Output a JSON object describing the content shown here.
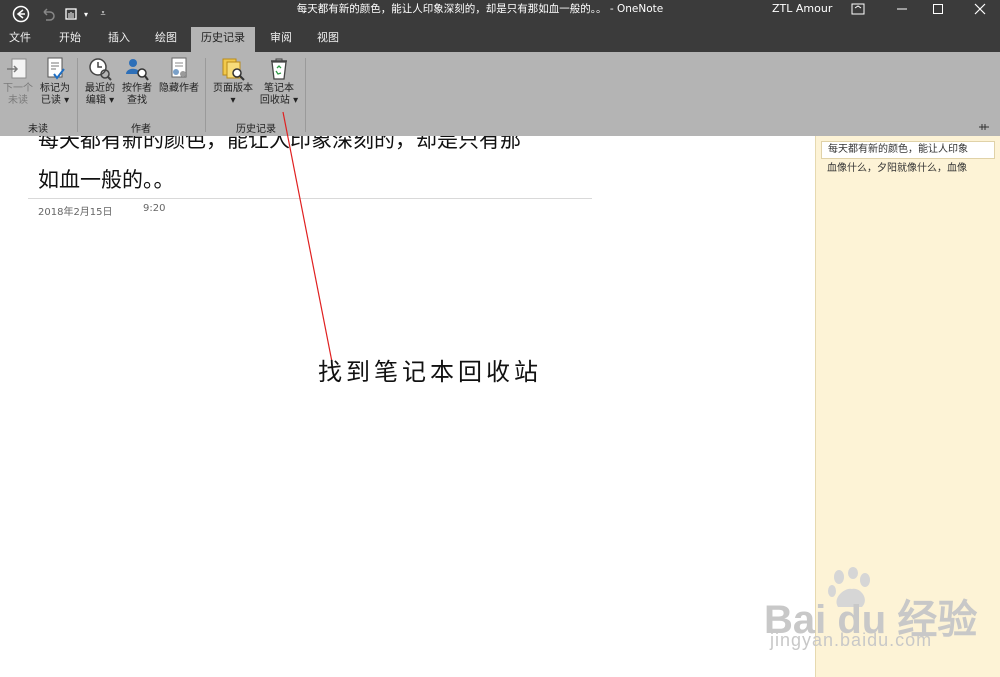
{
  "window": {
    "title": "每天都有新的颜色，能让人印象深刻的，却是只有那如血一般的。。 - OneNote",
    "user": "ZTL Amour",
    "controls": [
      "ribbon-display-icon",
      "minimize-icon",
      "maximize-icon",
      "close-icon"
    ]
  },
  "quick_access": [
    "back-icon",
    "undo-icon",
    "touch-mode-icon",
    "customize-icon"
  ],
  "tabs": [
    "文件",
    "开始",
    "插入",
    "绘图",
    "历史记录",
    "审阅",
    "视图"
  ],
  "active_tab": "历史记录",
  "ribbon": {
    "unread": {
      "next_label": "下一个\n未读",
      "mark_label": "标记为\n已读 ▾",
      "group": "未读"
    },
    "author": {
      "recent_label": "最近的\n编辑 ▾",
      "find_label": "按作者\n查找",
      "hide_label": "隐藏作者",
      "group": "作者"
    },
    "history": {
      "versions_label": "页面版本\n▾",
      "recycle_label": "笔记本\n回收站 ▾",
      "group": "历史记录"
    },
    "collapse_icon": "pin-icon"
  },
  "page": {
    "title_line1": "每天都有新的颜色，能让人印象深刻的，却是只有那",
    "title_line2": "如血一般的。。",
    "date": "2018年2月15日",
    "time": "9:20"
  },
  "page_list": [
    "每天都有新的颜色，能让人印象",
    "血像什么，夕阳就像什么，血像"
  ],
  "annotation": {
    "text": "找到笔记本回收站",
    "arrow_color": "#e02020"
  },
  "watermark": {
    "logo": "Bai du 经验",
    "url": "jingyan.baidu.com"
  },
  "colors": {
    "titlebar": "#3b3b3b",
    "ribbon": "#b4b4b4",
    "page_panel": "#fdf3d6"
  }
}
